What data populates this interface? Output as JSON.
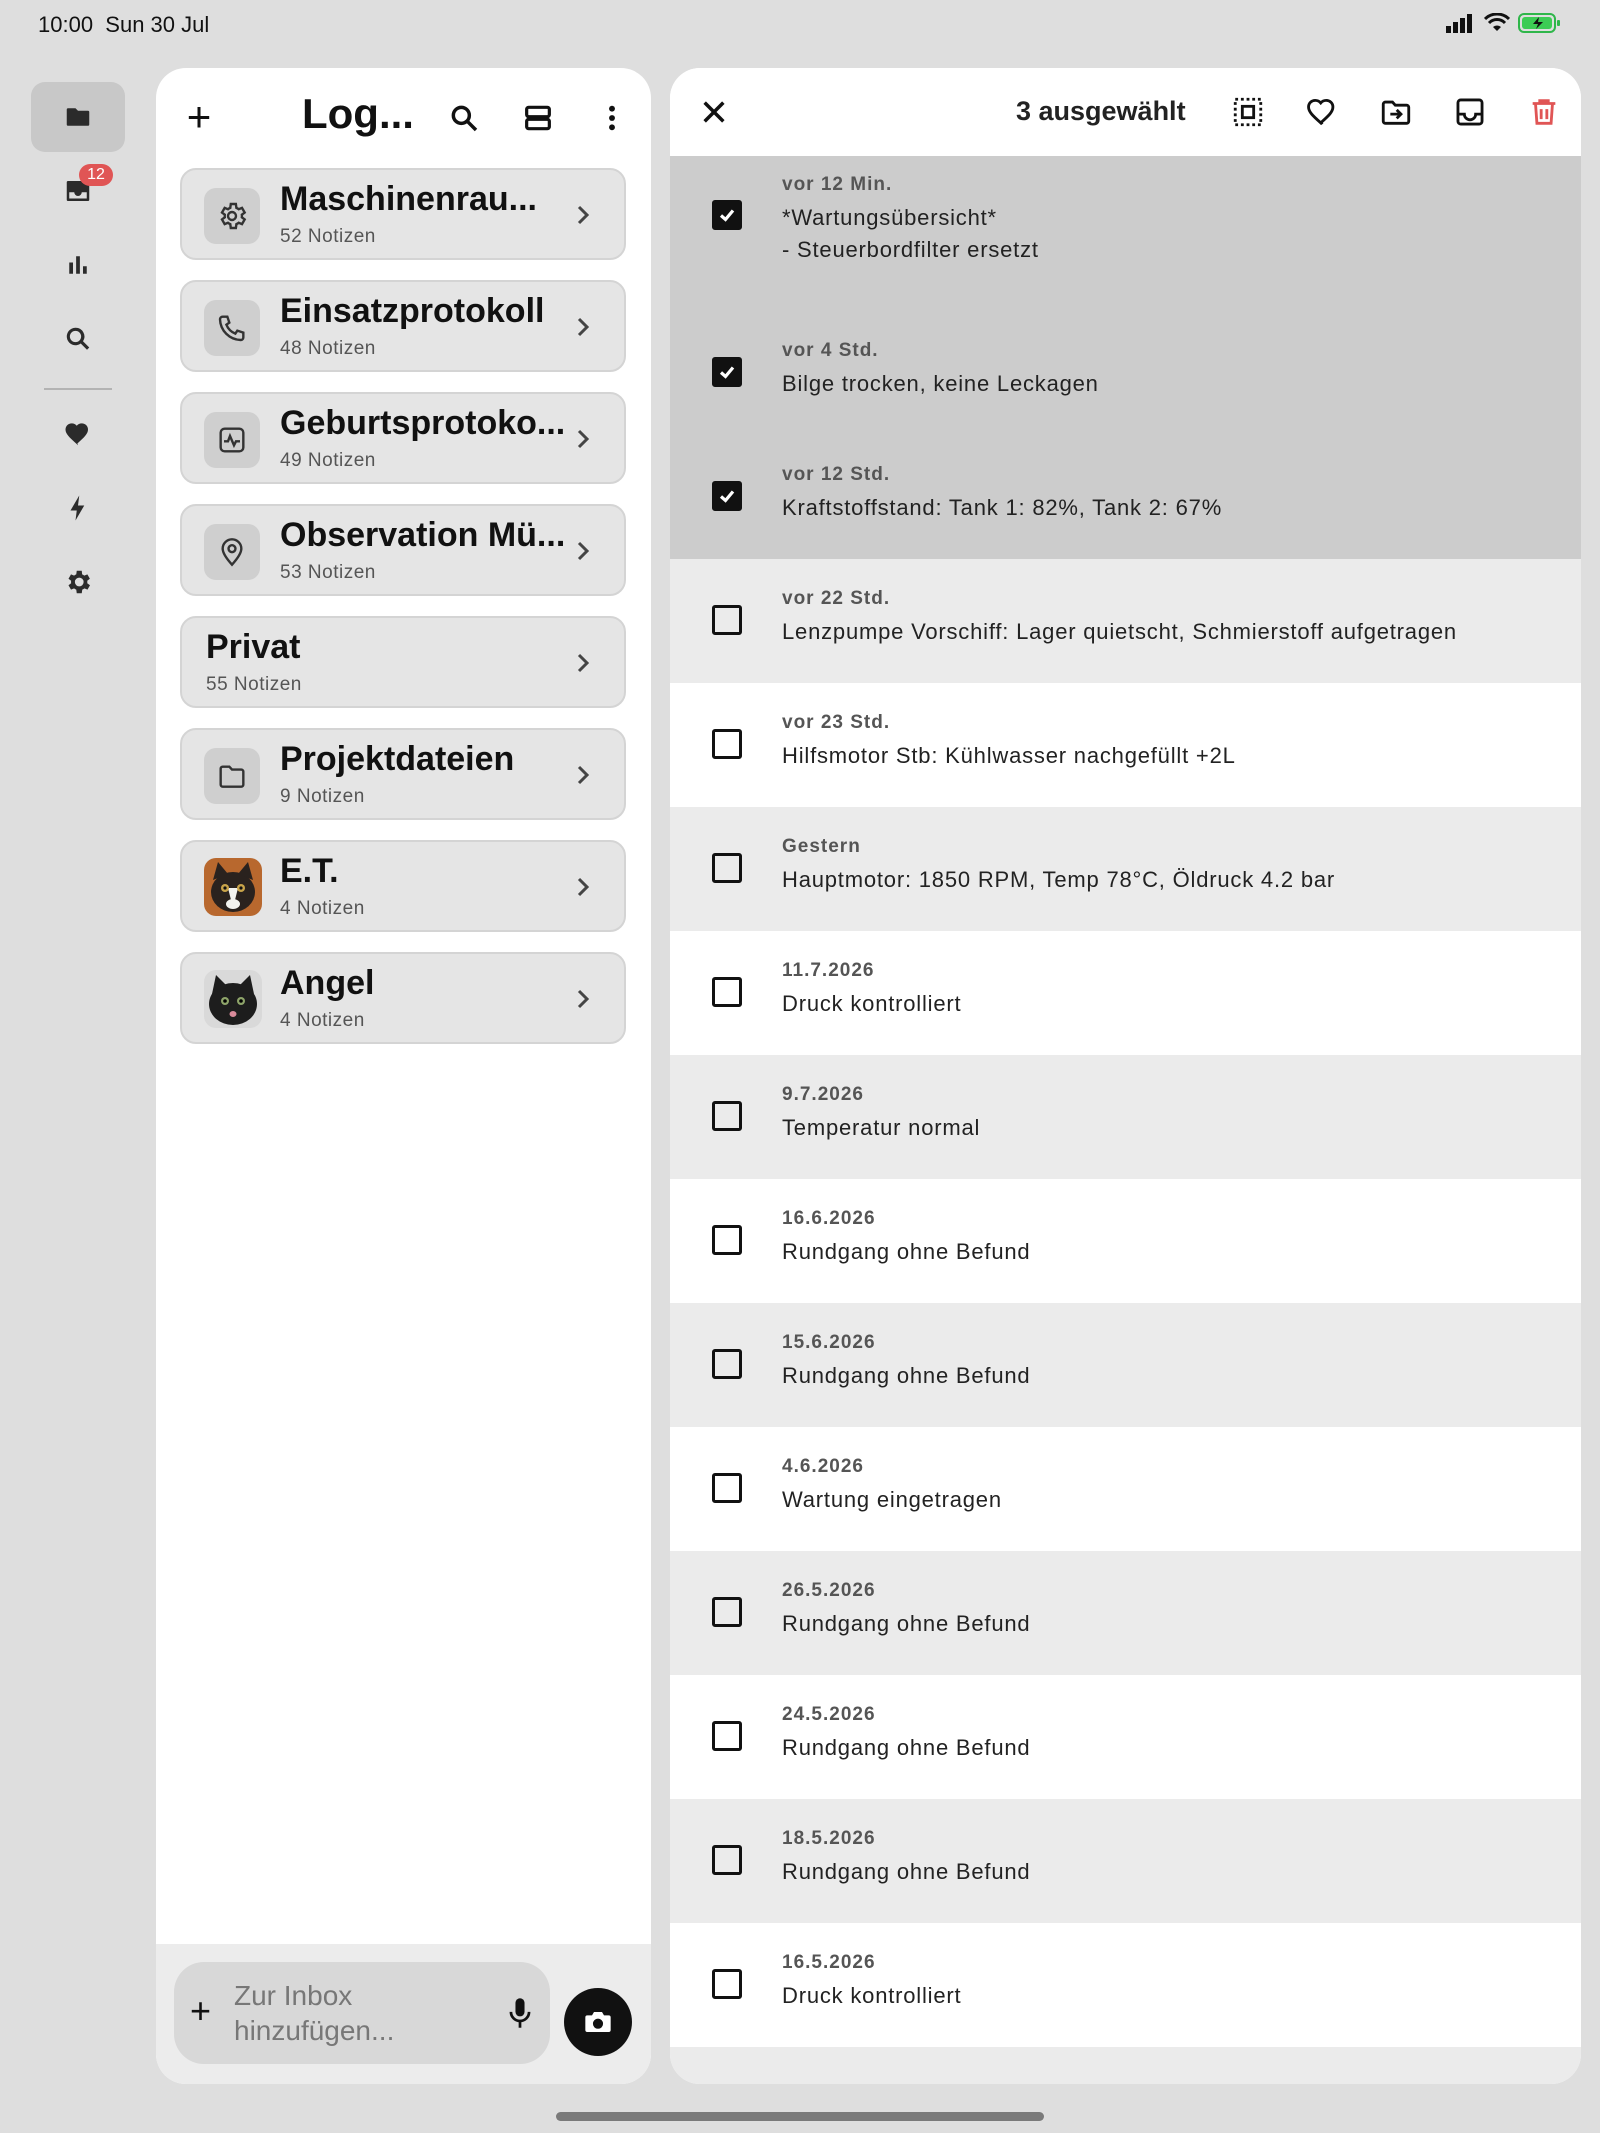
{
  "status_bar": {
    "time": "10:00",
    "date": "Sun 30 Jul"
  },
  "rail": {
    "items": [
      {
        "icon": "folder-icon",
        "active": true
      },
      {
        "icon": "inbox-icon",
        "badge": "12"
      },
      {
        "icon": "bar-chart-icon"
      },
      {
        "icon": "search-icon"
      },
      {
        "icon": "heart-icon"
      },
      {
        "icon": "lightning-icon"
      },
      {
        "icon": "gear-icon"
      }
    ]
  },
  "left_panel": {
    "title": "Log...",
    "folders": [
      {
        "name": "Maschinenrau...",
        "count": "52 Notizen",
        "icon": "gear-icon"
      },
      {
        "name": "Einsatzprotokoll",
        "count": "48 Notizen",
        "icon": "phone-icon"
      },
      {
        "name": "Geburtsprotoko...",
        "count": "49 Notizen",
        "icon": "heartbeat-icon"
      },
      {
        "name": "Observation Mü...",
        "count": "53 Notizen",
        "icon": "location-pin-icon"
      },
      {
        "name": "Privat",
        "count": "55 Notizen",
        "icon": ""
      },
      {
        "name": "Projektdateien",
        "count": "9 Notizen",
        "icon": "folder-outline-icon"
      },
      {
        "name": "E.T.",
        "count": "4 Notizen",
        "icon": "cat-avatar"
      },
      {
        "name": "Angel",
        "count": "4 Notizen",
        "icon": "cat-avatar"
      }
    ],
    "inbox_placeholder": "Zur Inbox hinzufügen..."
  },
  "right_panel": {
    "selected_label": "3 ausgewählt",
    "notes": [
      {
        "date": "vor 12 Min.",
        "text": "*Wartungsübersicht*",
        "text2": "- Steuerbordfilter ersetzt",
        "checked": true
      },
      {
        "date": "vor 4 Std.",
        "text": "Bilge trocken, keine Leckagen",
        "checked": true
      },
      {
        "date": "vor 12 Std.",
        "text": "Kraftstoffstand: Tank 1: 82%, Tank 2: 67%",
        "checked": true
      },
      {
        "date": "vor 22 Std.",
        "text": "Lenzpumpe Vorschiff: Lager quietscht, Schmierstoff aufgetragen",
        "checked": false
      },
      {
        "date": "vor 23 Std.",
        "text": "Hilfsmotor Stb: Kühlwasser nachgefüllt +2L",
        "checked": false
      },
      {
        "date": "Gestern",
        "text": "Hauptmotor: 1850 RPM, Temp 78°C, Öldruck 4.2 bar",
        "checked": false
      },
      {
        "date": "11.7.2026",
        "text": "Druck kontrolliert",
        "checked": false
      },
      {
        "date": "9.7.2026",
        "text": "Temperatur normal",
        "checked": false
      },
      {
        "date": "16.6.2026",
        "text": "Rundgang ohne Befund",
        "checked": false
      },
      {
        "date": "15.6.2026",
        "text": "Rundgang ohne Befund",
        "checked": false
      },
      {
        "date": "4.6.2026",
        "text": "Wartung eingetragen",
        "checked": false
      },
      {
        "date": "26.5.2026",
        "text": "Rundgang ohne Befund",
        "checked": false
      },
      {
        "date": "24.5.2026",
        "text": "Rundgang ohne Befund",
        "checked": false
      },
      {
        "date": "18.5.2026",
        "text": "Rundgang ohne Befund",
        "checked": false
      },
      {
        "date": "16.5.2026",
        "text": "Druck kontrolliert",
        "checked": false
      }
    ]
  },
  "colors": {
    "delete": "#e05555",
    "badge": "#e05555",
    "selected_row": "#cccccc"
  }
}
